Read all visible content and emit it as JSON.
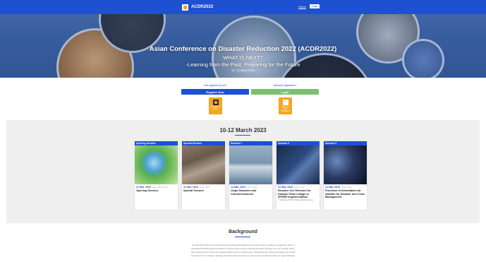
{
  "topbar": {
    "brand": "ACDR2022",
    "nav_link": "Home",
    "nav_button": "Login"
  },
  "hero": {
    "title": "Asian Conference on Disaster Reduction 2022 (ACDR2022)",
    "subtitle_1": "WHAT IS NEXT?",
    "subtitle_2": "-Learning from the Past, Preparing for the Future",
    "date": "10 - 12 March 2023"
  },
  "registration": {
    "not_registered": "Not registered yet?",
    "register_button": "Register Now",
    "already_registered": "Already registered?",
    "login_button": "Login",
    "tile_1": "Registration Guide",
    "tile_2": "Guide for Online Participants"
  },
  "sessions": {
    "heading": "10-12 March 2023",
    "cards": [
      {
        "tag": "Opening Session",
        "date": "11 Mar. 2023",
        "time": "Room : 09:30-10:00",
        "title": "Opening Session",
        "note": "",
        "image": "earth-in-grass"
      },
      {
        "tag": "Special Session",
        "date": "11 Mar. 2023",
        "time": "10:00 - 12:00",
        "title": "Special Session",
        "note": "",
        "image": "earthquake-rescue"
      },
      {
        "tag": "Session 1",
        "date": "12 Mar. 2023",
        "time": "13:00 - 15:00",
        "title": "Large Disasters and Countermeasures",
        "note": "",
        "image": "flood-car"
      },
      {
        "tag": "Session 2",
        "date": "12 Mar. 2023",
        "time": "15:30 - 17:30",
        "title": "Broaden Our Horizons for Disaster Risk Linkage in SFDRR Implementation",
        "note": "- Implication of FCDC Climate Disasters Nexus -",
        "image": "hands-keyboard"
      },
      {
        "tag": "Session 3",
        "date": "12 Mar. 2023",
        "time": "13:00 - 15:00",
        "title": "Provision of Information via Satellite for Disaster and Crisis Management",
        "note": "",
        "image": "satellite"
      }
    ]
  },
  "background": {
    "heading": "Background",
    "lines": [
      "The year 2023 marks the centennial of the Great Kanto Earthquake that struck Tokyo region in Japan on 1 September 1923. An",
      "estimated of 105,000 people were killed or missing and the economic suffered tremendous damages. The mix of people, both in",
      "Japan and around the world, have changed greatly in these a hundred years. Urbanization have progressed rapidly and our lives",
      "have become more. However, damages caused by disasters continue to exist, and we are also faced with new major challenges."
    ]
  },
  "colors": {
    "primary": "#1e50d2",
    "login_green": "#7cc070",
    "tile_orange": "#f5a623",
    "band_gray": "#efefef"
  }
}
